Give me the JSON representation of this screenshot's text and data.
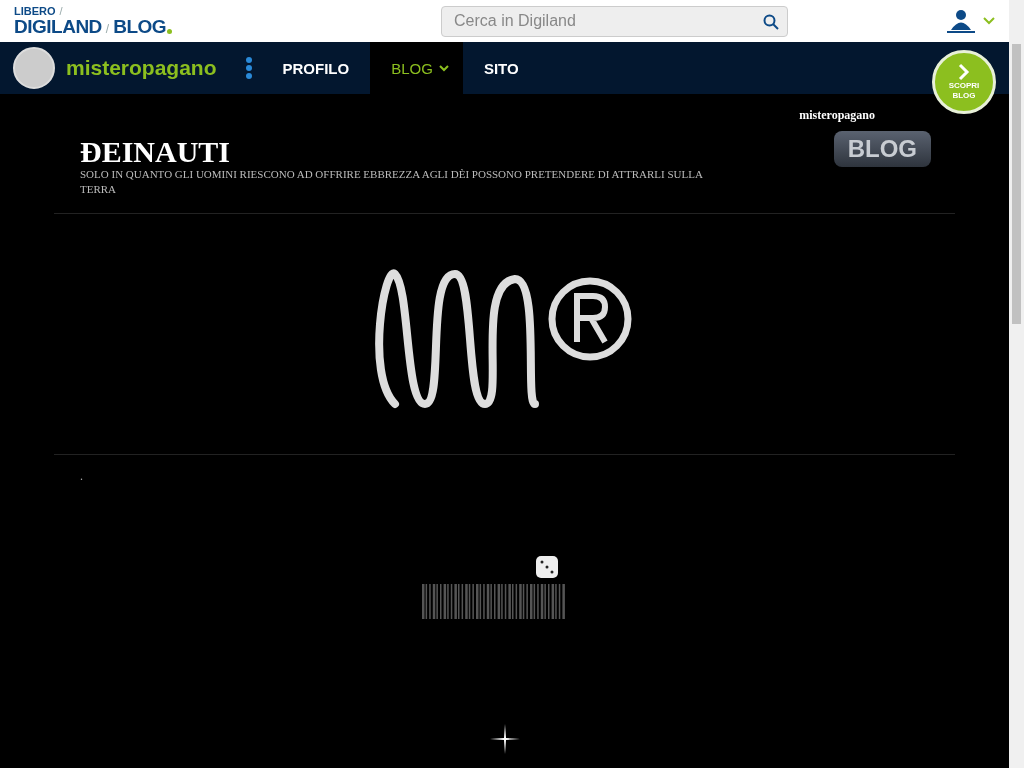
{
  "header": {
    "brand_top": "LIBERO",
    "brand_separator_top": "/",
    "brand_main": "DIGILAND",
    "brand_separator": "/",
    "brand_blog": "BLOG",
    "search": {
      "placeholder": "Cerca in Digiland"
    }
  },
  "profile_bar": {
    "username": "misteropagano",
    "tabs": [
      {
        "label": "PROFILO",
        "selected": false,
        "dropdown": false
      },
      {
        "label": "BLOG",
        "selected": true,
        "dropdown": true
      },
      {
        "label": "SITO",
        "selected": false,
        "dropdown": false
      }
    ],
    "discover_button": {
      "line1": "SCOPRI",
      "line2": "BLOG"
    }
  },
  "blog": {
    "author": "misteropagano",
    "title": "ĐEINAUTI",
    "subtitle": "SOLO IN QUANTO GLI UOMINI RIESCONO AD OFFRIRE EBBREZZA AGLI DÈI POSSONO PRETENDERE DI ATTRARLI SULLA TERRA",
    "badge": "BLOG",
    "post_text": "."
  }
}
